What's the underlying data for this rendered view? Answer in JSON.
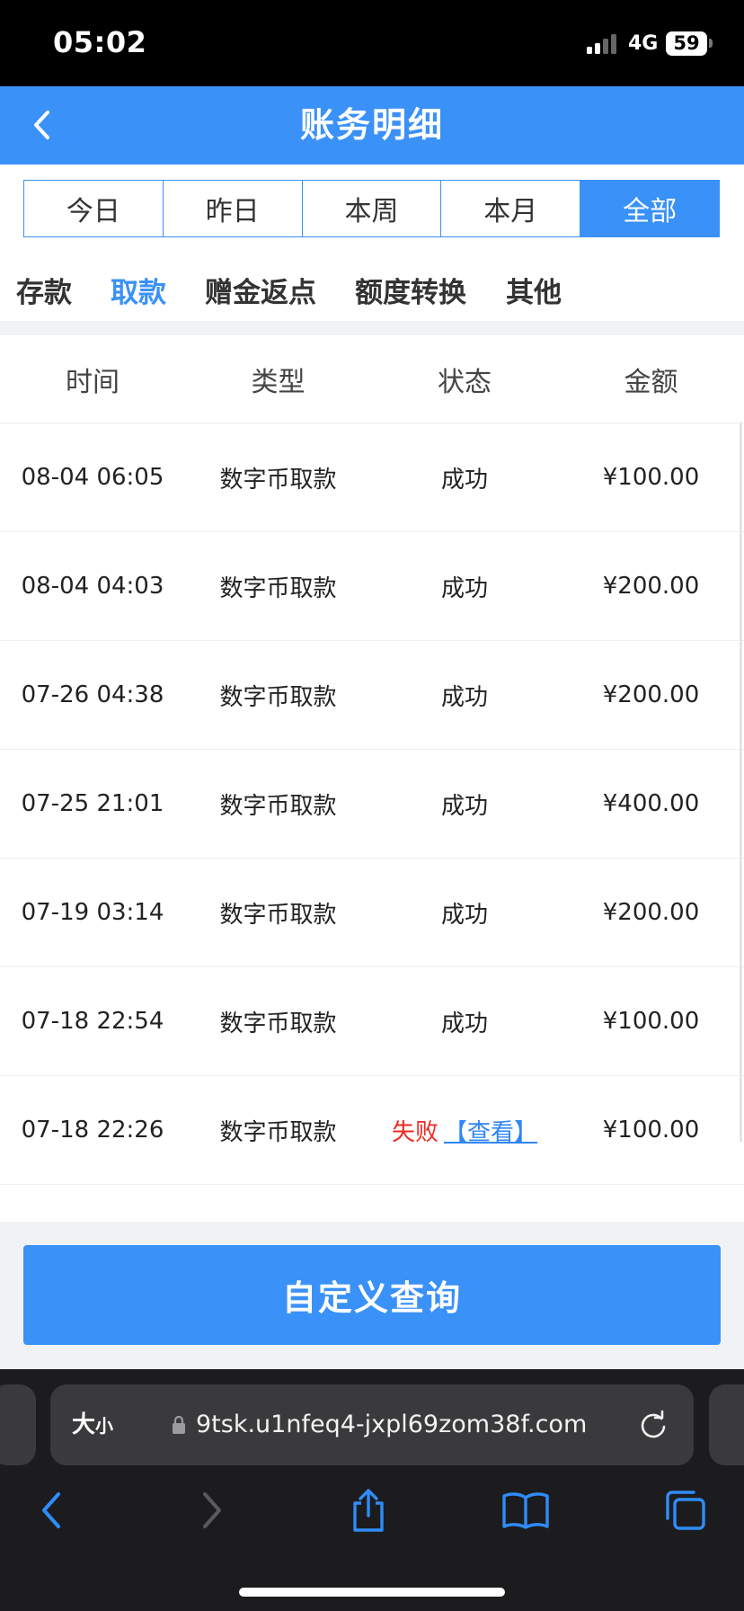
{
  "status_bar": {
    "time": "05:02",
    "network": "4G",
    "battery": "59"
  },
  "header": {
    "title": "账务明细",
    "back_icon": "chevron-left-icon"
  },
  "period_tabs": [
    {
      "label": "今日",
      "active": false
    },
    {
      "label": "昨日",
      "active": false
    },
    {
      "label": "本周",
      "active": false
    },
    {
      "label": "本月",
      "active": false
    },
    {
      "label": "全部",
      "active": true
    }
  ],
  "type_tabs": [
    {
      "label": "存款",
      "active": false
    },
    {
      "label": "取款",
      "active": true
    },
    {
      "label": "赠金返点",
      "active": false
    },
    {
      "label": "额度转换",
      "active": false
    },
    {
      "label": "其他",
      "active": false
    }
  ],
  "table": {
    "columns": [
      "时间",
      "类型",
      "状态",
      "金额"
    ],
    "rows": [
      {
        "time": "08-04 06:05",
        "type": "数字币取款",
        "status": "成功",
        "amount": "¥100.00"
      },
      {
        "time": "08-04 04:03",
        "type": "数字币取款",
        "status": "成功",
        "amount": "¥200.00"
      },
      {
        "time": "07-26 04:38",
        "type": "数字币取款",
        "status": "成功",
        "amount": "¥200.00"
      },
      {
        "time": "07-25 21:01",
        "type": "数字币取款",
        "status": "成功",
        "amount": "¥400.00"
      },
      {
        "time": "07-19 03:14",
        "type": "数字币取款",
        "status": "成功",
        "amount": "¥200.00"
      },
      {
        "time": "07-18 22:54",
        "type": "数字币取款",
        "status": "成功",
        "amount": "¥100.00"
      },
      {
        "time": "07-18 22:26",
        "type": "数字币取款",
        "status": "失败",
        "link": "【查看】",
        "amount": "¥100.00"
      }
    ]
  },
  "query_button": "自定义查询",
  "browser": {
    "text_size_big": "大",
    "text_size_small": "小",
    "url": "9tsk.u1nfeq4-jxpl69zom38f.com"
  },
  "colors": {
    "primary": "#3a91f8",
    "success": "#56b82a",
    "fail": "#ee2a24"
  }
}
